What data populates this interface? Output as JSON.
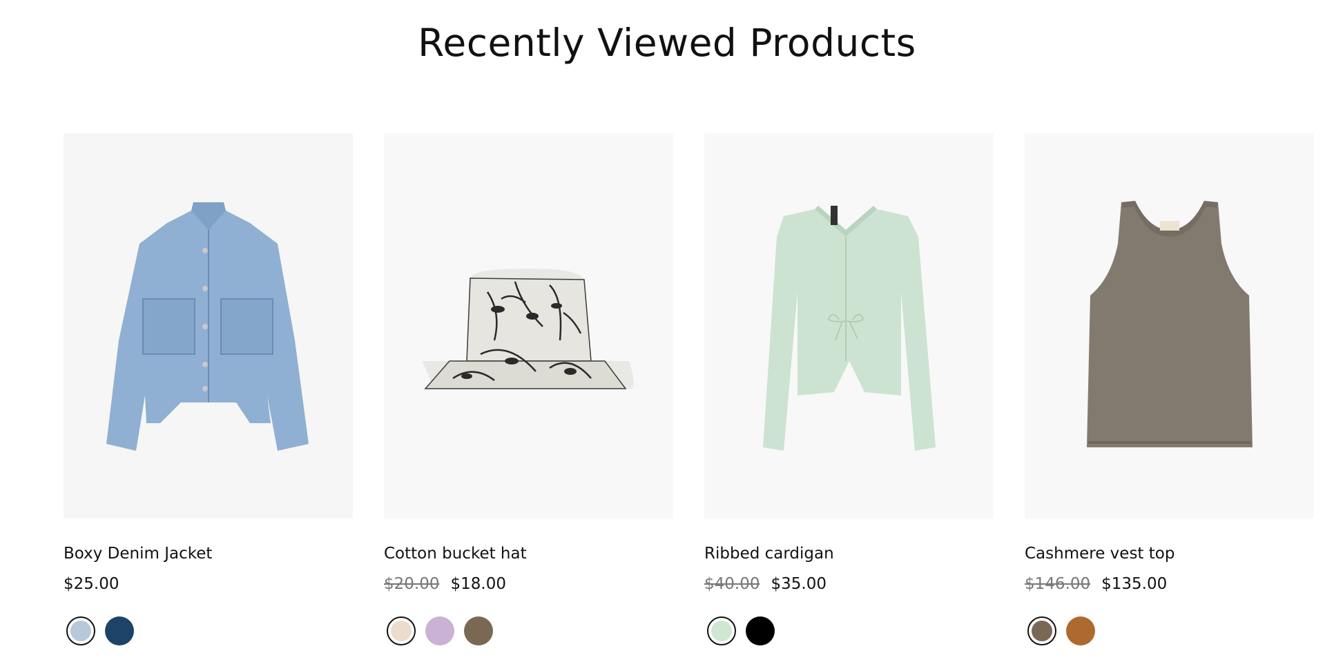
{
  "section": {
    "title": "Recently Viewed Products"
  },
  "products": [
    {
      "name": "Boxy Denim Jacket",
      "price": "$25.00",
      "compare_price": "",
      "image": "denim-jacket",
      "swatches": [
        {
          "color": "#b7c8d9",
          "selected": true
        },
        {
          "color": "#1d4368",
          "selected": false
        }
      ]
    },
    {
      "name": "Cotton bucket hat",
      "price": "$18.00",
      "compare_price": "$20.00",
      "image": "bucket-hat",
      "swatches": [
        {
          "color": "#ecdccb",
          "selected": true
        },
        {
          "color": "#c9b2d4",
          "selected": false
        },
        {
          "color": "#7b6853",
          "selected": false
        }
      ]
    },
    {
      "name": "Ribbed cardigan",
      "price": "$35.00",
      "compare_price": "$40.00",
      "image": "ribbed-cardigan",
      "swatches": [
        {
          "color": "#cfe6d0",
          "selected": true
        },
        {
          "color": "#000000",
          "selected": false
        }
      ]
    },
    {
      "name": "Cashmere vest top",
      "price": "$135.00",
      "compare_price": "$146.00",
      "image": "cashmere-vest",
      "swatches": [
        {
          "color": "#7a6854",
          "selected": true
        },
        {
          "color": "#ae6a2e",
          "selected": false
        }
      ]
    }
  ]
}
